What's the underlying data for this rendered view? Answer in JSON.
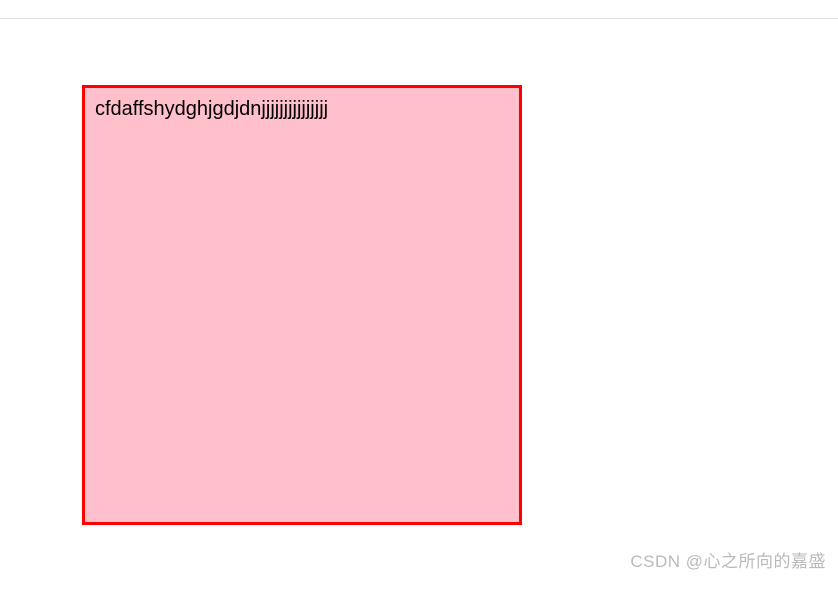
{
  "box": {
    "text": "cfdaffshydghjgdjdnjjjjjjjjjjjjjjj",
    "background_color": "#ffc0cb",
    "border_color": "#ff0000"
  },
  "watermark": {
    "text": "CSDN @心之所向的嘉盛"
  }
}
